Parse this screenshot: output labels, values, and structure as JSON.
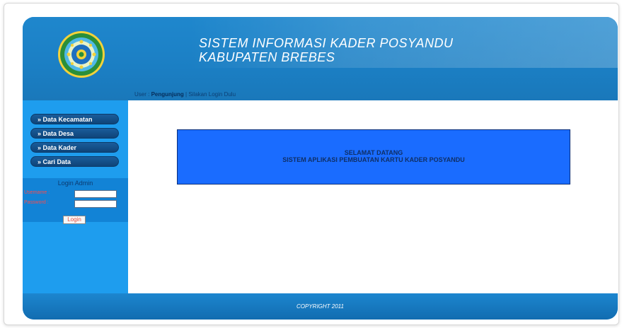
{
  "header": {
    "title_line1": "SISTEM INFORMASI KADER POSYANDU",
    "title_line2": "KABUPATEN BREBES",
    "logo_icon": "regency-emblem-icon"
  },
  "userbar": {
    "prefix": "User : ",
    "user": "Pengunjung",
    "separator": " | ",
    "message": "Silakan Login Dulu"
  },
  "sidebar": {
    "menu": [
      {
        "label": "» Data Kecamatan"
      },
      {
        "label": "» Data Desa"
      },
      {
        "label": "» Data Kader"
      },
      {
        "label": "» Cari Data"
      }
    ],
    "login": {
      "title": "Login Admin",
      "username_label": "Username :",
      "password_label": "Password :",
      "button": "Login"
    }
  },
  "main": {
    "welcome_line1": "SELAMAT DATANG",
    "welcome_line2": "SISTEM APLIKASI PEMBUATAN KARTU KADER POSYANDU"
  },
  "footer": {
    "copyright": "COPYRIGHT 2011"
  },
  "colors": {
    "header": "#1b7fc4",
    "sidebar": "#1e9dee",
    "welcome_box": "#1a6cff",
    "menu_button": "#0f4478"
  }
}
